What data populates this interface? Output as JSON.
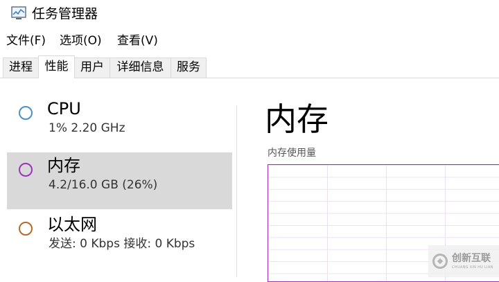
{
  "window": {
    "title": "任务管理器"
  },
  "menu": [
    "文件(F)",
    "选项(O)",
    "查看(V)"
  ],
  "tabs": [
    {
      "label": "进程",
      "active": false
    },
    {
      "label": "性能",
      "active": true
    },
    {
      "label": "用户",
      "active": false
    },
    {
      "label": "详细信息",
      "active": false
    },
    {
      "label": "服务",
      "active": false
    }
  ],
  "sidebar": {
    "items": [
      {
        "name": "CPU",
        "detail": "1%  2.20 GHz",
        "color": "#4a90c8",
        "selected": false
      },
      {
        "name": "内存",
        "detail": "4.2/16.0 GB (26%)",
        "color": "#9b33b5",
        "selected": true
      },
      {
        "name": "以太网",
        "detail": "发送: 0 Kbps  接收: 0 Kbps",
        "color": "#b8692a",
        "selected": false
      }
    ]
  },
  "main": {
    "title": "内存",
    "graph_label": "内存使用量",
    "graph_color": "#9b33b5"
  },
  "watermark": {
    "cn": "创新互联",
    "en": "CHUANG XIN HU LIAN"
  }
}
